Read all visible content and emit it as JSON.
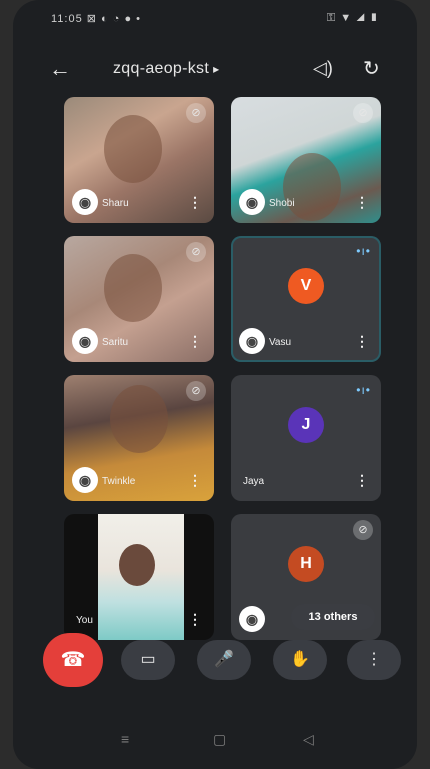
{
  "status": {
    "time": "11:05",
    "icons_left": "⊠ ◐ ◔ ● •",
    "icons_right": "⚿ ▼ ◢ ▮"
  },
  "header": {
    "back_icon": "←",
    "title": "zqq-aeop-kst",
    "caret": "▸",
    "audio_icon": "◁)",
    "switch_icon": "↻"
  },
  "tiles": [
    {
      "name": "Sharu",
      "speaking": false,
      "muted": true
    },
    {
      "name": "Shobi",
      "speaking": false,
      "muted": true
    },
    {
      "name": "Saritu",
      "speaking": false,
      "muted": true
    },
    {
      "name": "Vasu",
      "avatar": "V",
      "avatar_color": "#ef5a22",
      "speaking": true
    },
    {
      "name": "Twinkle",
      "speaking": false,
      "muted": true
    },
    {
      "name": "Jaya",
      "avatar": "J",
      "avatar_color": "#5a34b8",
      "speaking": true
    },
    {
      "name": "You",
      "muted": false
    },
    {
      "name": "13 others",
      "avatar": "H",
      "avatar_color": "#c44b22",
      "muted": true
    }
  ],
  "controls": {
    "end": "☎",
    "camera": "▭",
    "mic": "🎤",
    "hand": "✋",
    "more": "⋮"
  },
  "nav": {
    "recents": "≡",
    "home": "▢",
    "back": "◁"
  },
  "colors": {
    "end_call": "#e43f3a",
    "speaking": "#7ecbff"
  }
}
